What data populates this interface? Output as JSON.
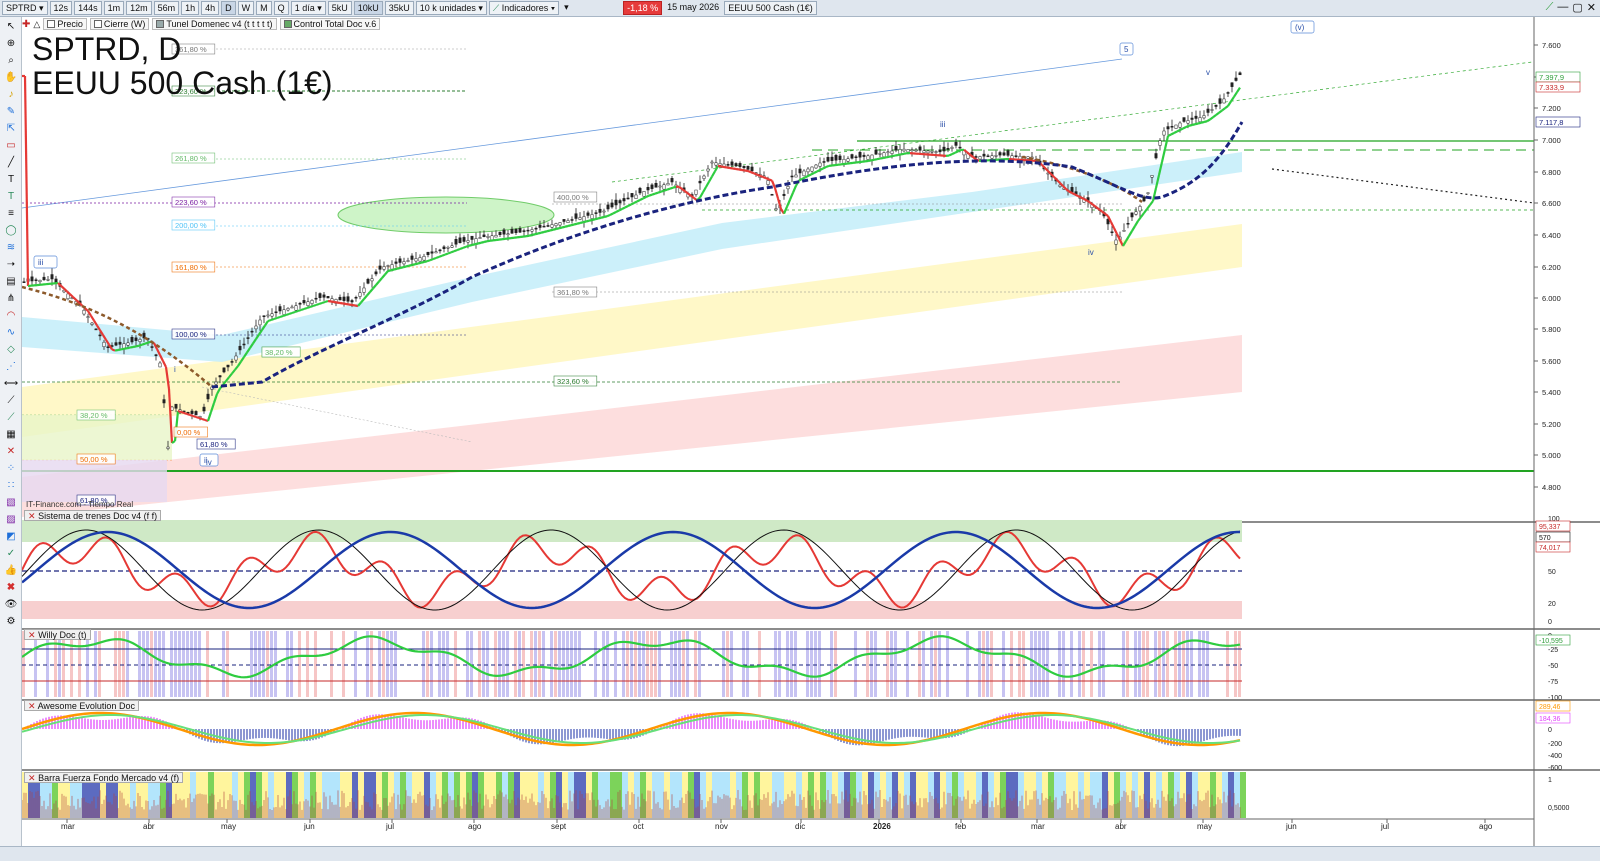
{
  "toolbar": {
    "symbol": "SPTRD",
    "timeframes": [
      "12s",
      "144s",
      "1m",
      "12m",
      "56m",
      "1h",
      "4h",
      "D",
      "W",
      "M",
      "Q"
    ],
    "active_timeframe": "D",
    "period": "1 día",
    "units": [
      "5kU",
      "10kU",
      "35kU"
    ],
    "active_unit": "10kU",
    "unit_select": "10 k unidades",
    "indicators": "Indicadores",
    "change": "-1,18 %",
    "date": "15 may 2026",
    "instrument": "EEUU 500 Cash (1€)"
  },
  "subbar": [
    "Precio",
    "Cierre (W)",
    "Tunel Domenec v4 (t t t t t)",
    "Control Total Doc v.6"
  ],
  "title": {
    "line1": "SPTRD, D",
    "line2": "EEUU 500 Cash (1€)"
  },
  "source": "IT-Finance.com - Tiempo Real",
  "price_axis": {
    "ticks": [
      "7.600",
      "7.400",
      "7.200",
      "7.000",
      "6.800",
      "6.600",
      "6.400",
      "6.200",
      "6.000",
      "5.800",
      "5.600",
      "5.400",
      "5.200",
      "5.000",
      "4.800"
    ]
  },
  "price_labels": [
    {
      "text": "7.397,9",
      "color": "#2e9e3a"
    },
    {
      "text": "7.333,9",
      "color": "#c62828"
    },
    {
      "text": "7.117,8",
      "color": "#1a237e"
    }
  ],
  "time_axis": [
    "mar",
    "abr",
    "may",
    "jun",
    "jul",
    "ago",
    "sept",
    "oct",
    "nov",
    "dic",
    "2026",
    "feb",
    "mar",
    "abr",
    "may",
    "jun",
    "jul",
    "ago"
  ],
  "fib_labels": [
    {
      "text": "361,80 %",
      "color": "#777"
    },
    {
      "text": "323,60 %",
      "color": "#2e7d32"
    },
    {
      "text": "261,80 %",
      "color": "#66bb6a"
    },
    {
      "text": "223,60 %",
      "color": "#7b1fa2"
    },
    {
      "text": "200,00 %",
      "color": "#4fc3f7"
    },
    {
      "text": "161,80 %",
      "color": "#ef6c00"
    },
    {
      "text": "100,00 %",
      "color": "#1a237e"
    },
    {
      "text": "38,20 %",
      "color": "#66bb6a"
    },
    {
      "text": "400,00 %",
      "color": "#777"
    },
    {
      "text": "361,80 %",
      "color": "#777"
    },
    {
      "text": "323,60 %",
      "color": "#2e7d32"
    },
    {
      "text": "38,20 %",
      "color": "#2e7d32"
    },
    {
      "text": "50,00 %",
      "color": "#ef6c00"
    },
    {
      "text": "61,80 %",
      "color": "#1a237e"
    },
    {
      "text": "61,80 %",
      "color": "#1a237e"
    },
    {
      "text": "0,00 %",
      "color": "#ef6c00"
    },
    {
      "text": "38,20 %",
      "color": "#66bb6a"
    }
  ],
  "wave_labels": [
    "5",
    "(v)",
    "iii",
    "ii",
    "i",
    "iv",
    "iii",
    "iv",
    "v"
  ],
  "panels": [
    {
      "title": "Sistema de trenes Doc v4 (f f)",
      "ticks": [
        "100",
        "80",
        "50",
        "20",
        "0"
      ],
      "values": [
        "95,337",
        "570",
        "74,017"
      ]
    },
    {
      "title": "Willy Doc (t)",
      "ticks": [
        "0",
        "-25",
        "-50",
        "-75",
        "-100"
      ],
      "values": [
        "-10,595"
      ]
    },
    {
      "title": "Awesome Evolution Doc",
      "ticks": [
        "200",
        "0",
        "-200",
        "-400",
        "-600"
      ],
      "values": [
        "289,46",
        "184,36"
      ]
    },
    {
      "title": "Barra Fuerza Fondo Mercado v4 (f)",
      "ticks": [
        "1",
        "0,5000"
      ],
      "values": [
        "0,4463"
      ]
    }
  ],
  "colors": {
    "bull": "#2ecc40",
    "bear": "#e53935",
    "ema": "#1a237e",
    "brown": "#8d5a2b"
  },
  "icons": [
    "cursor-icon",
    "zoom-icon",
    "magnify-icon",
    "hand-icon",
    "bell-icon",
    "pen-icon",
    "line-icon",
    "text-icon",
    "fib-icon",
    "check-icon",
    "thumb-icon",
    "delete-icon"
  ]
}
